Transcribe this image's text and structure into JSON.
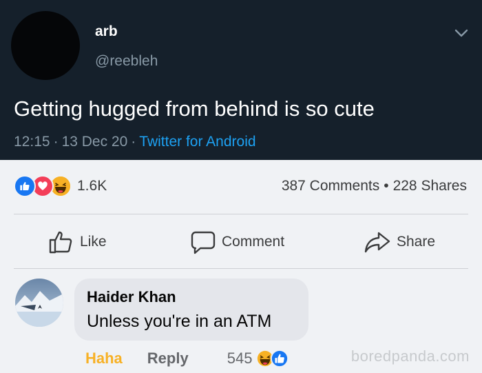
{
  "tweet": {
    "display_name": "arb",
    "handle": "@reebleh",
    "text": "Getting hugged from behind is so cute",
    "time": "12:15",
    "date": "13 Dec 20",
    "client": "Twitter for Android",
    "separator": "·"
  },
  "post": {
    "reaction_count": "1.6K",
    "reaction_icons": [
      "like-icon",
      "love-icon",
      "haha-icon"
    ],
    "comments": "387 Comments",
    "shares": "228 Shares",
    "dot": "•",
    "actions": {
      "like": "Like",
      "comment": "Comment",
      "share": "Share"
    }
  },
  "comment": {
    "author": "Haider Khan",
    "text": "Unless you're in an ATM",
    "reaction_label": "Haha",
    "reply_label": "Reply",
    "reaction_count": "545",
    "reaction_icons": [
      "haha-icon",
      "like-icon"
    ]
  },
  "watermark": "boredpanda.com",
  "colors": {
    "tweet_bg": "#15202b",
    "tweet_secondary": "#8899a6",
    "tweet_link": "#1da1f2",
    "fb_bg": "#f0f2f5",
    "fb_blue": "#1877f2",
    "haha_yellow": "#f7b125",
    "love_red": "#f33e58"
  }
}
